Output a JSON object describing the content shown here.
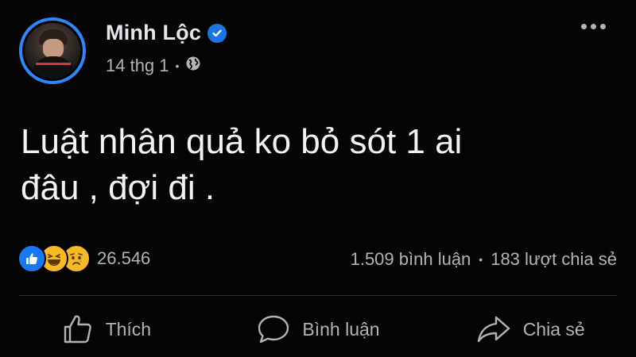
{
  "post": {
    "author": "Minh Lộc",
    "verified_icon": "verified-badge-icon",
    "date": "14 thg 1",
    "separator": "•",
    "audience_icon": "globe-icon",
    "more_icon": "more-options-icon",
    "text_line1": "Luật nhân quả ko bỏ sót 1 ai",
    "text_line2": "đâu , đợi đi ."
  },
  "reactions": {
    "icons": [
      "like-icon",
      "haha-icon",
      "sad-icon"
    ],
    "count": "26.546"
  },
  "stats": {
    "comments": "1.509 bình luận",
    "separator": "•",
    "shares": "183 lượt chia sẻ"
  },
  "actions": {
    "like_label": "Thích",
    "comment_label": "Bình luận",
    "share_label": "Chia sẻ"
  },
  "colors": {
    "background": "#050505",
    "accent": "#1877f2",
    "text_primary": "#e4e6eb",
    "text_secondary": "#b0b3b8"
  }
}
